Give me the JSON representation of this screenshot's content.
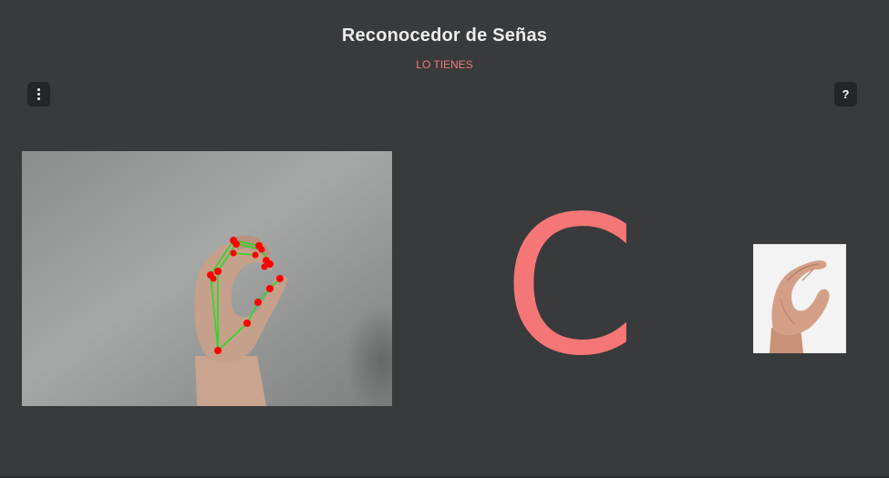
{
  "header": {
    "title": "Reconocedor de Señas",
    "status": "LO TIENES"
  },
  "toolbar": {
    "menu_icon": "vertical-dots-icon",
    "help_label": "?"
  },
  "recognition": {
    "predicted_letter": "C"
  },
  "colors": {
    "background": "#383a3c",
    "accent": "#f57676",
    "landmark_point": "#ff0000",
    "landmark_line": "#22dd22"
  }
}
